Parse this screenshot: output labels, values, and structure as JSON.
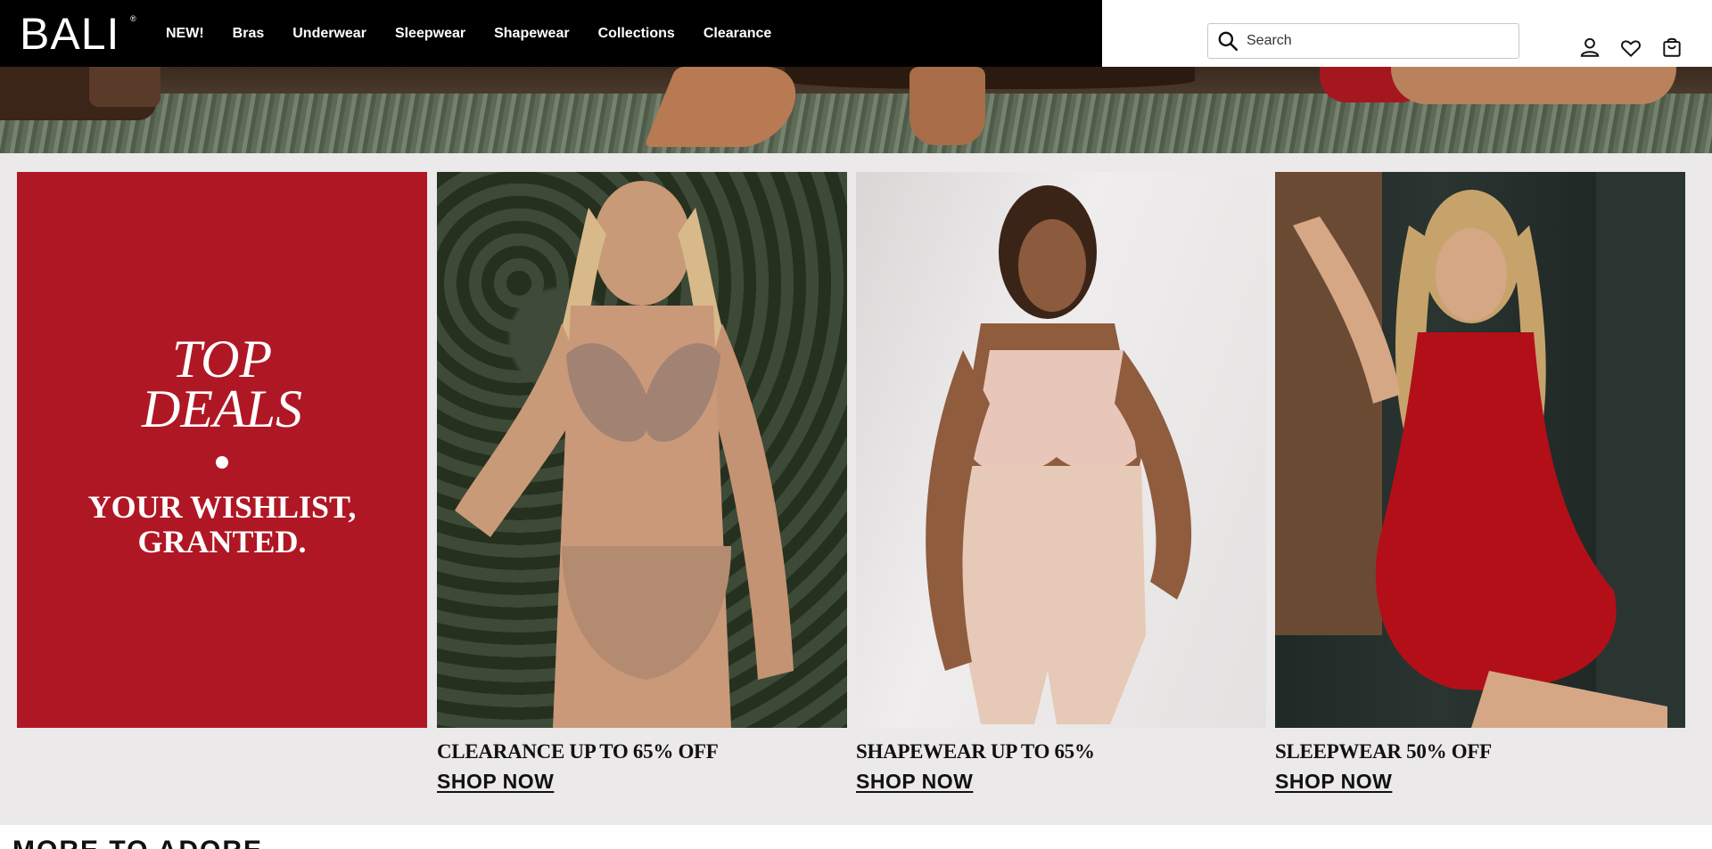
{
  "brand": {
    "logo": "BALI",
    "registered": "®"
  },
  "nav": {
    "items": [
      {
        "label": "NEW!"
      },
      {
        "label": "Bras"
      },
      {
        "label": "Underwear"
      },
      {
        "label": "Sleepwear"
      },
      {
        "label": "Shapewear"
      },
      {
        "label": "Collections"
      },
      {
        "label": "Clearance"
      }
    ]
  },
  "search": {
    "placeholder": "Search",
    "value": ""
  },
  "header_icons": [
    "account-icon",
    "wishlist-heart-icon",
    "shopping-bag-icon"
  ],
  "promo": {
    "headline": {
      "line1": "TOP",
      "line2": "DEALS",
      "sub1": "YOUR WISHLIST,",
      "sub2": "GRANTED."
    },
    "cards": [
      {
        "caption": "CLEARANCE UP TO 65% OFF",
        "cta": "SHOP NOW"
      },
      {
        "caption": "SHAPEWEAR UP TO 65%",
        "cta": "SHOP NOW"
      },
      {
        "caption": "SLEEPWEAR 50% OFF",
        "cta": "SHOP NOW"
      }
    ]
  },
  "next_section": {
    "title": "MORE TO ADORE"
  },
  "colors": {
    "brand_red": "#b01724",
    "header_black": "#000000",
    "promo_bg": "#ebe9ea"
  }
}
